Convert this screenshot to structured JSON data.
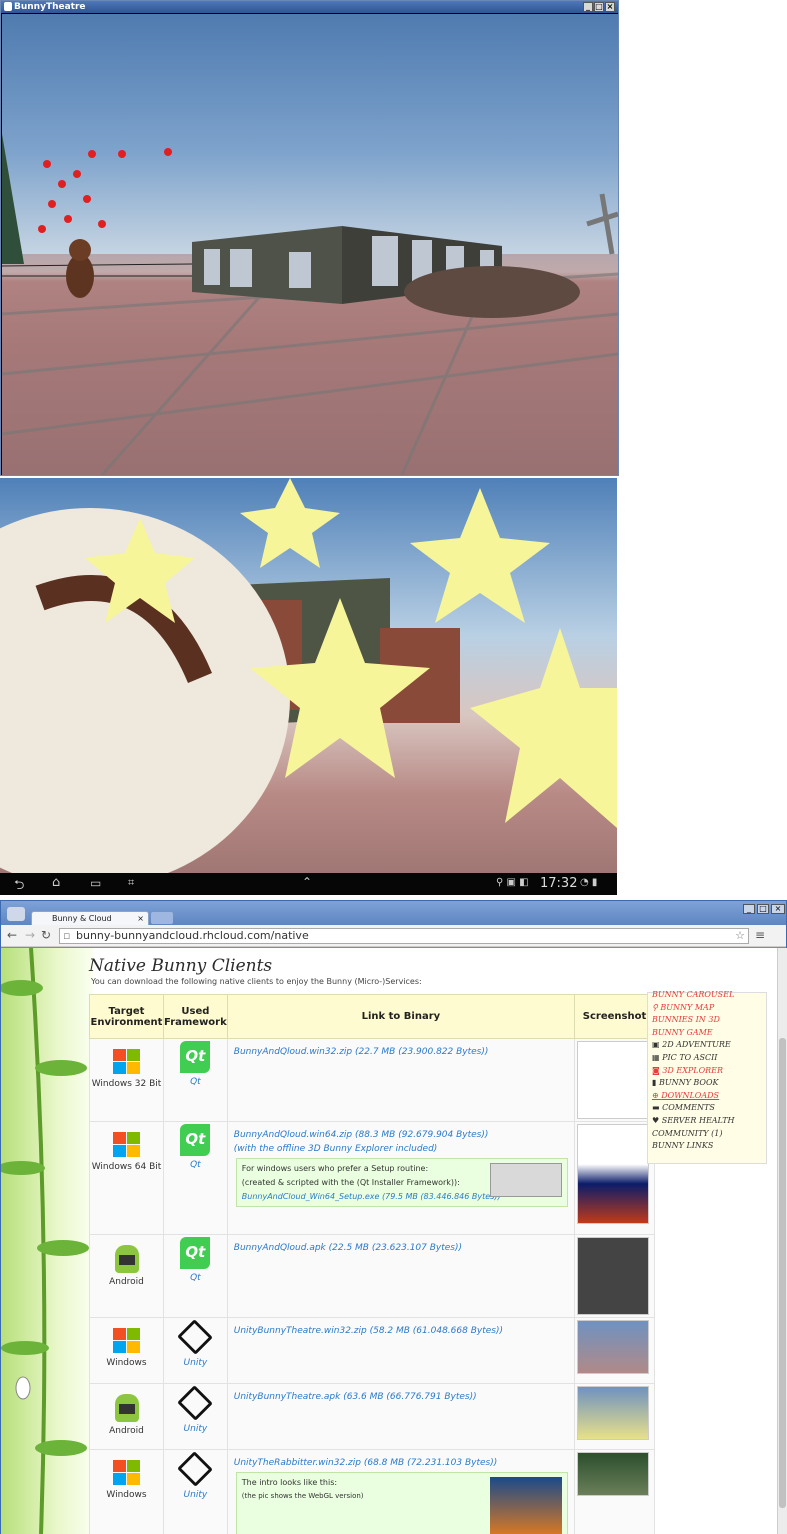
{
  "game_window": {
    "title": "BunnyTheatre",
    "minimize": "_",
    "maximize": "□",
    "close": "×"
  },
  "tablet_bar": {
    "time": "17:32"
  },
  "browser": {
    "tab_title": "Bunny & Cloud",
    "url": "bunny-bunnyandcloud.rhcloud.com/native",
    "page": {
      "title": "Native Bunny Clients",
      "subtitle": "You can download the following native clients to enjoy the Bunny (Micro-)Services:",
      "headers": [
        "Target Environment",
        "Used Framework",
        "Link to Binary",
        "Screenshot"
      ],
      "rows": [
        {
          "env": "Windows 32 Bit",
          "fw": "Qt",
          "link": "BunnyAndQloud.win32.zip (22.7 MB (23.900.822 Bytes))"
        },
        {
          "env": "Windows 64 Bit",
          "fw": "Qt",
          "link": "BunnyAndQloud.win64.zip (88.3 MB (92.679.904 Bytes))",
          "extra": "(with the offline 3D Bunny Explorer included)",
          "note": [
            "For windows users who prefer a Setup routine:",
            "(created & scripted with the (Qt Installer Framework)):",
            "BunnyAndCloud_Win64_Setup.exe (79.5 MB (83.446.846 Bytes))"
          ]
        },
        {
          "env": "Android",
          "fw": "Qt",
          "link": "BunnyAndQloud.apk (22.5 MB (23.623.107 Bytes))"
        },
        {
          "env": "Windows",
          "fw": "Unity",
          "link": "UnityBunnyTheatre.win32.zip (58.2 MB (61.048.668 Bytes))"
        },
        {
          "env": "Android",
          "fw": "Unity",
          "link": "UnityBunnyTheatre.apk (63.6 MB (66.776.791 Bytes))"
        },
        {
          "env": "Windows",
          "fw": "Unity",
          "link": "UnityTheRabbitter.win32.zip (68.8 MB (72.231.103 Bytes))",
          "note": [
            "The intro looks like this:",
            "(the pic shows the WebGL version)"
          ]
        }
      ]
    },
    "menu": [
      "BUNNY CAROUSEL",
      "BUNNY MAP",
      "BUNNIES IN 3D",
      "BUNNY GAME",
      "2D ADVENTURE",
      "PIC TO ASCII",
      "3D EXPLORER",
      "BUNNY BOOK",
      "DOWNLOADS",
      "COMMENTS",
      "SERVER HEALTH",
      "COMMUNITY (1)",
      "BUNNY LINKS"
    ]
  }
}
